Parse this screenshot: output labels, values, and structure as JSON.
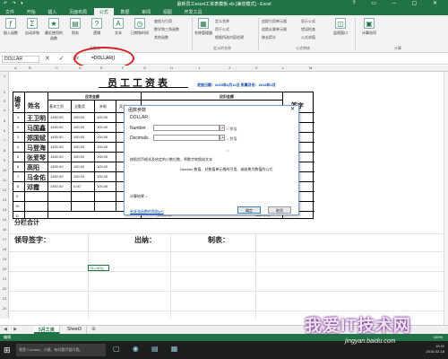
{
  "window": {
    "title": "最新员工excel工资表模板.xls [兼容模式] - Excel",
    "qat": "↶ ↷ ▾"
  },
  "ribbon_tabs": [
    "文件",
    "开始",
    "插入",
    "页面布局",
    "公式",
    "数据",
    "审阅",
    "视图",
    "开发工具"
  ],
  "active_tab": "公式",
  "ribbon": {
    "insert_function": "插入函数",
    "autosum": "自动求和",
    "recent": "最近使用的函数",
    "financial": "财务",
    "logical": "逻辑",
    "text": "文本",
    "datetime": "日期和时间",
    "lookup": "查找与引用",
    "math": "数学和三角函数",
    "more": "其他函数",
    "group_library": "函数库",
    "name_manager": "名称管理器",
    "define_name": "定义名称",
    "use_in_formula": "用于公式",
    "create_from_sel": "根据所选内容创建",
    "group_names": "定义的名称",
    "trace_precedents": "追踪引用单元格",
    "trace_dependents": "追踪从属单元格",
    "remove_arrows": "移去箭头",
    "show_formulas": "显示公式",
    "error_check": "错误检查",
    "evaluate": "公式求值",
    "group_audit": "公式审核",
    "watch": "监视窗口",
    "calc_options": "计算选项",
    "group_calc": "计算"
  },
  "formula_bar": {
    "name_box": "DOLLAR",
    "formula": "=DOLLAR()",
    "fx": "fx",
    "buttons": "✕ ✓"
  },
  "columns": [
    "A",
    "B",
    "C",
    "D",
    "E",
    "F",
    "G",
    "H",
    "I",
    "J",
    "K",
    "L",
    "M"
  ],
  "rows": [
    "1",
    "2",
    "3",
    "4",
    "5",
    "6",
    "7",
    "8",
    "9",
    "10",
    "11",
    "12",
    "13",
    "14",
    "15",
    "16",
    "17",
    "18",
    "19",
    "20",
    "21",
    "22",
    "23",
    "24",
    "25",
    "26",
    "27",
    "28"
  ],
  "sheet": {
    "title": "员工工资表",
    "meta": "发放日期：2015年2月12日  所属月份：2015年1月",
    "header_no": "编号",
    "header_name": "姓名",
    "group_payable": "应发金额",
    "group_deduct": "应扣金额",
    "sub_headers": [
      "基本工资",
      "全勤奖",
      "补助",
      "奖金"
    ],
    "sign_header": "签字",
    "employees": [
      {
        "no": "1",
        "name": "王卫明",
        "base": "1450.00",
        "full": "150.00",
        "sub": "100.00"
      },
      {
        "no": "2",
        "name": "马国鑫",
        "base": "1450.00",
        "full": "150.00",
        "sub": "100.00"
      },
      {
        "no": "3",
        "name": "郑国斌",
        "base": "1450.00",
        "full": "150.00",
        "sub": "100.00"
      },
      {
        "no": "4",
        "name": "马登海",
        "base": "1450.00",
        "full": "150.00",
        "sub": "100.00"
      },
      {
        "no": "5",
        "name": "张爱琴",
        "base": "1450.00",
        "full": "150.00",
        "sub": "100.00"
      },
      {
        "no": "6",
        "name": "高阳",
        "base": "1450.00",
        "full": "150.00",
        "sub": "100.00"
      },
      {
        "no": "7",
        "name": "马金佑",
        "base": "1450.00",
        "full": "150.00",
        "sub": "100.00"
      },
      {
        "no": "8",
        "name": "邓霞",
        "base": "1450.00",
        "full": "0.00",
        "sub": "100.00"
      }
    ],
    "extra_rows": [
      "9",
      "10",
      "11"
    ],
    "subtotal_label": "分栏合计",
    "subtotal_a": "19000.00",
    "subtotal_b": "18070.00",
    "leader_sign": "领导签字：",
    "cashier": "出纳：",
    "preparer": "制表：",
    "active_cell_text": "OLLAR()"
  },
  "dialog": {
    "title": "函数参数",
    "close": "✕",
    "function_name": "DOLLAR",
    "arg1_label": "Number",
    "arg1_value": "= 数值",
    "arg2_label": "Decimals",
    "arg2_value": "= 数值",
    "equals": "=",
    "description": "按照货币格式及给定的小数位数，将数字转换成文本",
    "arg_description": "Number  数值、对数值单元格的引用、或结果为数值的公式",
    "result": "计算结果 =",
    "help": "有关该函数的帮助(H)",
    "ok": "确定",
    "cancel": "取消"
  },
  "sheet_tabs": [
    "5月工资",
    "Sheet3"
  ],
  "active_sheet": "5月工资",
  "status": {
    "mode": "编辑",
    "zoom": "100%"
  },
  "taskbar": {
    "search_placeholder": "我是 Cortana，小娜。有问题尽管问我。",
    "time": "19:32",
    "date": "2016-02-18"
  },
  "watermark": {
    "main": "我爱IT技术网",
    "url": "jingyan.baidu.com"
  }
}
